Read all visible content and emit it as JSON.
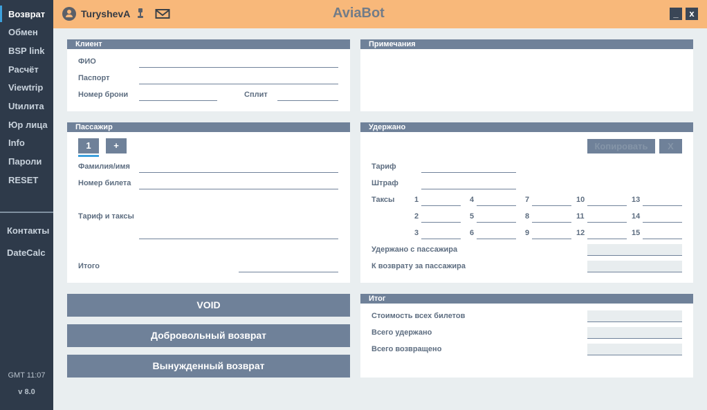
{
  "sidebar": {
    "items": [
      "Возврат",
      "Обмен",
      "BSP link",
      "Расчёт",
      "Viewtrip",
      "Utилита",
      "Юр лица",
      "Info",
      "Пароли",
      "RESET"
    ],
    "contacts": "Контакты",
    "datecalc": "DateCalc",
    "time": "GMT 11:07",
    "version": "v 8.0"
  },
  "header": {
    "username": "TuryshevA",
    "app_title": "AviaBot",
    "minimize": "_",
    "close": "x"
  },
  "client": {
    "title": "Клиент",
    "fio_label": "ФИО",
    "passport_label": "Паспорт",
    "booking_label": "Номер брони",
    "split_label": "Сплит"
  },
  "notes": {
    "title": "Примечания"
  },
  "passenger": {
    "title": "Пассажир",
    "tab_1": "1",
    "tab_add": "+",
    "name_label": "Фамилия/имя",
    "ticket_label": "Номер билета",
    "fare_label": "Тариф и таксы",
    "total_label": "Итого"
  },
  "withheld": {
    "title": "Удержано",
    "copy_button": "Копировать",
    "clear_button": "X",
    "fare_label": "Тариф",
    "penalty_label": "Штраф",
    "taxes_label": "Таксы",
    "tax_numbers": [
      "1",
      "2",
      "3",
      "4",
      "5",
      "6",
      "7",
      "8",
      "9",
      "10",
      "11",
      "12",
      "13",
      "14",
      "15"
    ],
    "withheld_from_pax_label": "Удержано с пассажира",
    "refund_for_pax_label": "К возврату за пассажира"
  },
  "summary": {
    "title": "Итог",
    "total_cost_label": "Стоимость всех билетов",
    "total_withheld_label": "Всего удержано",
    "total_refunded_label": "Всего возвращено"
  },
  "actions": {
    "void": "VOID",
    "voluntary": "Добровольный возврат",
    "involuntary": "Вынужденный возврат"
  },
  "colors": {
    "header_bg": "#f8b87a",
    "sidebar_bg": "#2e3a4a",
    "panel_head": "#6f8199",
    "accent": "#3da0dc"
  }
}
